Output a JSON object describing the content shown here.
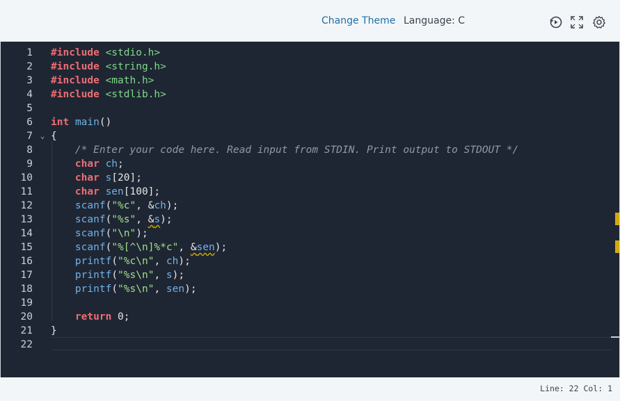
{
  "toolbar": {
    "change_theme": "Change Theme",
    "language": "Language: C",
    "icons": [
      "history-icon",
      "fullscreen-icon",
      "settings-icon"
    ]
  },
  "editor": {
    "lines": [
      "#include <stdio.h>",
      "#include <string.h>",
      "#include <math.h>",
      "#include <stdlib.h>",
      "",
      "int main()",
      "{",
      "    /* Enter your code here. Read input from STDIN. Print output to STDOUT */",
      "    char ch;",
      "    char s[20];",
      "    char sen[100];",
      "    scanf(\"%c\", &ch);",
      "    scanf(\"%s\", &s);",
      "    scanf(\"\\n\");",
      "    scanf(\"%[^\\n]%*c\", &sen);",
      "    printf(\"%c\\n\", ch);",
      "    printf(\"%s\\n\", s);",
      "    printf(\"%s\\n\", sen);",
      "",
      "    return 0;",
      "}",
      ""
    ],
    "line_numbers": [
      "1",
      "2",
      "3",
      "4",
      "5",
      "6",
      "7",
      "8",
      "9",
      "10",
      "11",
      "12",
      "13",
      "14",
      "15",
      "16",
      "17",
      "18",
      "19",
      "20",
      "21",
      "22"
    ]
  },
  "status": {
    "position": "Line: 22 Col: 1"
  },
  "colors": {
    "editor_bg": "#1f2633",
    "keyword": "#ee6e73",
    "string": "#9fe28a",
    "identifier": "#6fb3ea",
    "warning_marker": "#d4a90d",
    "link": "#1f6ea8"
  }
}
